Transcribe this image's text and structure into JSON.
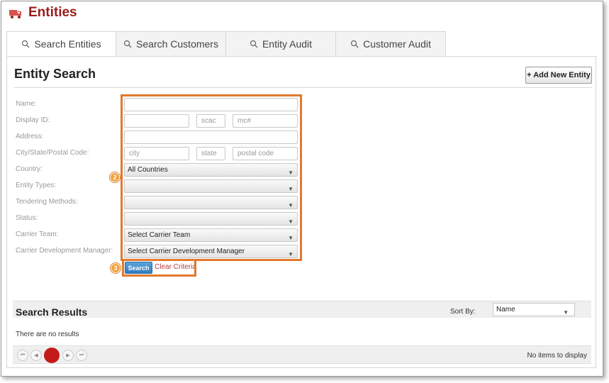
{
  "app": {
    "title": "Entities",
    "icon": "truck-icon"
  },
  "tabs": [
    {
      "label": "Search Entities",
      "icon": "search-icon"
    },
    {
      "label": "Search Customers",
      "icon": "search-icon"
    },
    {
      "label": "Entity Audit",
      "icon": "search-icon"
    },
    {
      "label": "Customer Audit",
      "icon": "search-icon"
    }
  ],
  "page": {
    "title": "Entity Search",
    "add_button": "+ Add New Entity"
  },
  "form": {
    "labels": {
      "name": "Name:",
      "display_id": "Display ID:",
      "address": "Address:",
      "city_state_postal": "City/State/Postal Code:",
      "country": "Country:",
      "entity_types": "Entity Types:",
      "tendering_methods": "Tendering Methods:",
      "status": "Status:",
      "carrier_team": "Carrier Team:",
      "carrier_dev_manager": "Carrier Development Manager:"
    },
    "placeholders": {
      "scac": "scac",
      "mc": "mc#",
      "city": "city",
      "state": "state",
      "postal_code": "postal code"
    },
    "selects": {
      "country": "All Countries",
      "entity_types": "",
      "tendering_methods": "",
      "status": "",
      "carrier_team": "Select Carrier Team",
      "carrier_dev_manager": "Select Carrier Development Manager"
    },
    "search_button": "Search",
    "clear_link": "Clear Criteria"
  },
  "callouts": {
    "form_badge": "2",
    "actions_badge": "3",
    "color": "#e2792c"
  },
  "results": {
    "title": "Search Results",
    "sort_label": "Sort By:",
    "sort_value": "Name",
    "empty_text": "There are no results",
    "pager_status": "No items to display"
  },
  "colors": {
    "brand": "#9b1c1c",
    "search_button": "#2f7cc0",
    "pager_current": "#c41a1a"
  }
}
